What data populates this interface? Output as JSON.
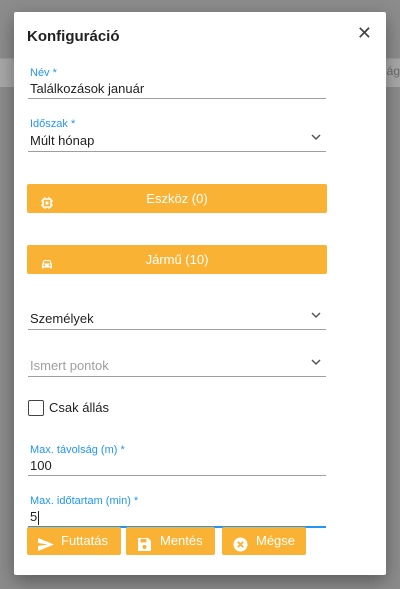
{
  "background": {
    "partial_text": "ág"
  },
  "dialog": {
    "title": "Konfiguráció",
    "close_glyph": "✕",
    "fields": {
      "name": {
        "label": "Név *",
        "value": "Találkozások január"
      },
      "period": {
        "label": "Időszak *",
        "value": "Múlt hónap"
      },
      "persons": {
        "value": "Személyek"
      },
      "known_points": {
        "placeholder": "Ismert pontok"
      },
      "max_distance": {
        "label": "Max. távolság (m) *",
        "value": "100"
      },
      "max_duration": {
        "label": "Max. időtartam (min) *",
        "value": "5"
      }
    },
    "device_button": {
      "label": "Eszköz (0)",
      "icon": "chip-icon"
    },
    "vehicle_button": {
      "label": "Jármű (10)",
      "icon": "car-icon"
    },
    "standing_only": {
      "label": "Csak állás",
      "checked": false
    },
    "footer": {
      "run": {
        "label": "Futtatás",
        "icon": "send-icon"
      },
      "save": {
        "label": "Mentés",
        "icon": "floppy-icon"
      },
      "cancel": {
        "label": "Mégse",
        "icon": "cancel-circle-icon"
      }
    },
    "colors": {
      "accent": "#f9b233",
      "label_blue": "#2196f3"
    }
  }
}
